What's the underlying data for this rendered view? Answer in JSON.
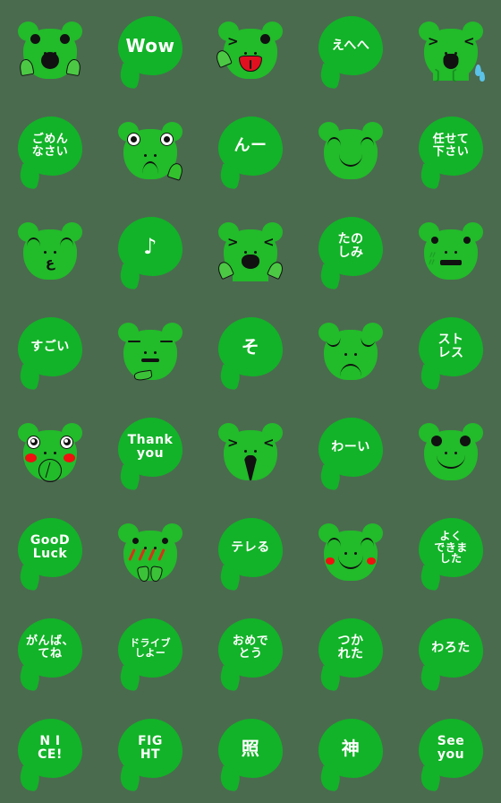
{
  "meta": {
    "title": "Frog Emoji Sticker Set",
    "background_color": "#4a6b4e",
    "bubble_color": "#12b328",
    "frog_color": "#22bb2a",
    "text_color": "#ffffff",
    "outline_color": "#111111",
    "blush_color": "#f01010",
    "tongue_color": "#e01020",
    "tear_color": "#5bc3e8",
    "columns": 5,
    "rows": 8,
    "count": 40
  },
  "stickers": [
    {
      "index": 1,
      "type": "frog",
      "name": "frog-open-mouth-hands-up",
      "text": ""
    },
    {
      "index": 2,
      "type": "bubble",
      "name": "bubble-wow",
      "text": "Wow"
    },
    {
      "index": 3,
      "type": "frog",
      "name": "frog-wink-tongue-out",
      "text": ""
    },
    {
      "index": 4,
      "type": "bubble",
      "name": "bubble-ehehe",
      "text": "えへへ"
    },
    {
      "index": 5,
      "type": "frog",
      "name": "frog-crying-tears",
      "text": ""
    },
    {
      "index": 6,
      "type": "bubble",
      "name": "bubble-gomennasai",
      "text": "ごめん\nなさい"
    },
    {
      "index": 7,
      "type": "frog",
      "name": "frog-puzzled-hand",
      "text": ""
    },
    {
      "index": 8,
      "type": "bubble",
      "name": "bubble-nn",
      "text": "んー"
    },
    {
      "index": 9,
      "type": "frog",
      "name": "frog-content-smile",
      "text": ""
    },
    {
      "index": 10,
      "type": "bubble",
      "name": "bubble-makasete-kudasai",
      "text": "任せて\n下さい"
    },
    {
      "index": 11,
      "type": "frog",
      "name": "frog-kiss-closed-eyes",
      "text": ""
    },
    {
      "index": 12,
      "type": "bubble",
      "name": "bubble-music-note",
      "text": "♪"
    },
    {
      "index": 13,
      "type": "frog",
      "name": "frog-cheer-arms-raised",
      "text": ""
    },
    {
      "index": 14,
      "type": "bubble",
      "name": "bubble-tanoshimi",
      "text": "たの\nしみ"
    },
    {
      "index": 15,
      "type": "frog",
      "name": "frog-nervous-sweat-flat-mouth",
      "text": ""
    },
    {
      "index": 16,
      "type": "bubble",
      "name": "bubble-sugoi",
      "text": "すごい"
    },
    {
      "index": 17,
      "type": "frog",
      "name": "frog-bored-flat-eyes-hand",
      "text": ""
    },
    {
      "index": 18,
      "type": "bubble",
      "name": "bubble-so",
      "text": "そ"
    },
    {
      "index": 19,
      "type": "frog",
      "name": "frog-sad-frown",
      "text": ""
    },
    {
      "index": 20,
      "type": "bubble",
      "name": "bubble-sutoresu",
      "text": "スト\nレス"
    },
    {
      "index": 21,
      "type": "frog",
      "name": "frog-blushing-sparkle-eyes",
      "text": ""
    },
    {
      "index": 22,
      "type": "bubble",
      "name": "bubble-thank-you",
      "text": "Thank\nyou"
    },
    {
      "index": 23,
      "type": "frog",
      "name": "frog-shouting-wide-mouth",
      "text": ""
    },
    {
      "index": 24,
      "type": "bubble",
      "name": "bubble-wai",
      "text": "わーい"
    },
    {
      "index": 25,
      "type": "frog",
      "name": "frog-big-smile",
      "text": ""
    },
    {
      "index": 26,
      "type": "bubble",
      "name": "bubble-good-luck",
      "text": "GooD\nLuck"
    },
    {
      "index": 27,
      "type": "frog",
      "name": "frog-embarrassed-blush-lines",
      "text": ""
    },
    {
      "index": 28,
      "type": "bubble",
      "name": "bubble-tereru",
      "text": "テレる"
    },
    {
      "index": 29,
      "type": "frog",
      "name": "frog-happy-blush-closed-eyes",
      "text": ""
    },
    {
      "index": 30,
      "type": "bubble",
      "name": "bubble-yoku-dekimashita",
      "text": "よく\nできま\nした"
    },
    {
      "index": 31,
      "type": "bubble",
      "name": "bubble-ganbattene",
      "text": "がんば、\nてね"
    },
    {
      "index": 32,
      "type": "bubble",
      "name": "bubble-drive-shiyo",
      "text": "ドライブ\nしよー"
    },
    {
      "index": 33,
      "type": "bubble",
      "name": "bubble-omedetou",
      "text": "おめで\nとう"
    },
    {
      "index": 34,
      "type": "bubble",
      "name": "bubble-tsukareta",
      "text": "つか\nれた"
    },
    {
      "index": 35,
      "type": "bubble",
      "name": "bubble-warota",
      "text": "わろた"
    },
    {
      "index": 36,
      "type": "bubble",
      "name": "bubble-nice",
      "text": "N I\nCE!"
    },
    {
      "index": 37,
      "type": "bubble",
      "name": "bubble-fight",
      "text": "FIG\nHT"
    },
    {
      "index": 38,
      "type": "bubble",
      "name": "bubble-teru",
      "text": "照"
    },
    {
      "index": 39,
      "type": "bubble",
      "name": "bubble-kami",
      "text": "神"
    },
    {
      "index": 40,
      "type": "bubble",
      "name": "bubble-see-you",
      "text": "See\nyou"
    }
  ]
}
